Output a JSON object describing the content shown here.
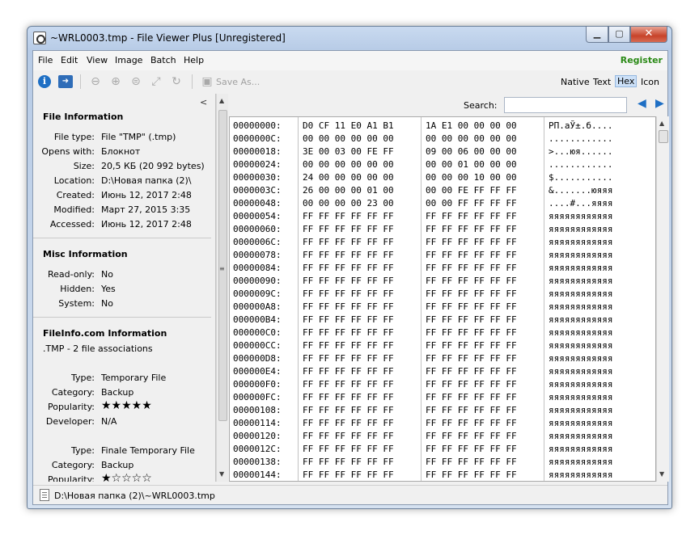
{
  "window": {
    "title": "~WRL0003.tmp - File Viewer Plus [Unregistered]",
    "min": "▁",
    "max": "▢",
    "close": "✕"
  },
  "menu": {
    "items": [
      "File",
      "Edit",
      "View",
      "Image",
      "Batch",
      "Help"
    ],
    "register": "Register"
  },
  "toolbar": {
    "save_label": "Save As...",
    "view_modes": [
      "Native",
      "Text",
      "Hex",
      "Icon"
    ],
    "active_view": "Hex"
  },
  "left_pane": {
    "collapse_glyph": "<",
    "file_info": {
      "heading": "File Information",
      "rows": [
        {
          "label": "File type:",
          "value": "File \"TMP\" (.tmp)"
        },
        {
          "label": "Opens with:",
          "value": "Блокнот"
        },
        {
          "label": "Size:",
          "value": "20,5 КБ (20 992 bytes)"
        },
        {
          "label": "Location:",
          "value": "D:\\Новая папка (2)\\"
        },
        {
          "label": "Created:",
          "value": "Июнь 12, 2017 2:48"
        },
        {
          "label": "Modified:",
          "value": "Март 27, 2015 3:35"
        },
        {
          "label": "Accessed:",
          "value": "Июнь 12, 2017 2:48"
        }
      ]
    },
    "misc_info": {
      "heading": "Misc Information",
      "rows": [
        {
          "label": "Read-only:",
          "value": "No"
        },
        {
          "label": "Hidden:",
          "value": "Yes"
        },
        {
          "label": "System:",
          "value": "No"
        }
      ]
    },
    "fileinfo_com": {
      "heading": "FileInfo.com Information",
      "associations": ".TMP - 2 file associations",
      "entries": [
        {
          "type_label": "Type:",
          "type": "Temporary File",
          "category_label": "Category:",
          "category": "Backup",
          "popularity_label": "Popularity:",
          "popularity_stars": "★★★★★",
          "developer_label": "Developer:",
          "developer": "N/A"
        },
        {
          "type_label": "Type:",
          "type": "Finale Temporary File",
          "category_label": "Category:",
          "category": "Backup",
          "popularity_label": "Popularity:",
          "popularity_stars": "★☆☆☆☆"
        }
      ]
    }
  },
  "search": {
    "label": "Search:",
    "value": "",
    "prev": "◀",
    "next": "▶"
  },
  "hex_rows": [
    {
      "offset": "00000000:",
      "h1": "D0 CF 11 E0 A1 B1",
      "h2": "1A E1 00 00 00 00",
      "ascii": "РП.аЎ±.б...."
    },
    {
      "offset": "0000000C:",
      "h1": "00 00 00 00 00 00",
      "h2": "00 00 00 00 00 00",
      "ascii": "............"
    },
    {
      "offset": "00000018:",
      "h1": "3E 00 03 00 FE FF",
      "h2": "09 00 06 00 00 00",
      "ascii": ">...юя......"
    },
    {
      "offset": "00000024:",
      "h1": "00 00 00 00 00 00",
      "h2": "00 00 01 00 00 00",
      "ascii": "............"
    },
    {
      "offset": "00000030:",
      "h1": "24 00 00 00 00 00",
      "h2": "00 00 00 10 00 00",
      "ascii": "$..........."
    },
    {
      "offset": "0000003C:",
      "h1": "26 00 00 00 01 00",
      "h2": "00 00 FE FF FF FF",
      "ascii": "&.......юяяя"
    },
    {
      "offset": "00000048:",
      "h1": "00 00 00 00 23 00",
      "h2": "00 00 FF FF FF FF",
      "ascii": "....#...яяяя"
    },
    {
      "offset": "00000054:",
      "h1": "FF FF FF FF FF FF",
      "h2": "FF FF FF FF FF FF",
      "ascii": "яяяяяяяяяяяя"
    },
    {
      "offset": "00000060:",
      "h1": "FF FF FF FF FF FF",
      "h2": "FF FF FF FF FF FF",
      "ascii": "яяяяяяяяяяяя"
    },
    {
      "offset": "0000006C:",
      "h1": "FF FF FF FF FF FF",
      "h2": "FF FF FF FF FF FF",
      "ascii": "яяяяяяяяяяяя"
    },
    {
      "offset": "00000078:",
      "h1": "FF FF FF FF FF FF",
      "h2": "FF FF FF FF FF FF",
      "ascii": "яяяяяяяяяяяя"
    },
    {
      "offset": "00000084:",
      "h1": "FF FF FF FF FF FF",
      "h2": "FF FF FF FF FF FF",
      "ascii": "яяяяяяяяяяяя"
    },
    {
      "offset": "00000090:",
      "h1": "FF FF FF FF FF FF",
      "h2": "FF FF FF FF FF FF",
      "ascii": "яяяяяяяяяяяя"
    },
    {
      "offset": "0000009C:",
      "h1": "FF FF FF FF FF FF",
      "h2": "FF FF FF FF FF FF",
      "ascii": "яяяяяяяяяяяя"
    },
    {
      "offset": "000000A8:",
      "h1": "FF FF FF FF FF FF",
      "h2": "FF FF FF FF FF FF",
      "ascii": "яяяяяяяяяяяя"
    },
    {
      "offset": "000000B4:",
      "h1": "FF FF FF FF FF FF",
      "h2": "FF FF FF FF FF FF",
      "ascii": "яяяяяяяяяяяя"
    },
    {
      "offset": "000000C0:",
      "h1": "FF FF FF FF FF FF",
      "h2": "FF FF FF FF FF FF",
      "ascii": "яяяяяяяяяяяя"
    },
    {
      "offset": "000000CC:",
      "h1": "FF FF FF FF FF FF",
      "h2": "FF FF FF FF FF FF",
      "ascii": "яяяяяяяяяяяя"
    },
    {
      "offset": "000000D8:",
      "h1": "FF FF FF FF FF FF",
      "h2": "FF FF FF FF FF FF",
      "ascii": "яяяяяяяяяяяя"
    },
    {
      "offset": "000000E4:",
      "h1": "FF FF FF FF FF FF",
      "h2": "FF FF FF FF FF FF",
      "ascii": "яяяяяяяяяяяя"
    },
    {
      "offset": "000000F0:",
      "h1": "FF FF FF FF FF FF",
      "h2": "FF FF FF FF FF FF",
      "ascii": "яяяяяяяяяяяя"
    },
    {
      "offset": "000000FC:",
      "h1": "FF FF FF FF FF FF",
      "h2": "FF FF FF FF FF FF",
      "ascii": "яяяяяяяяяяяя"
    },
    {
      "offset": "00000108:",
      "h1": "FF FF FF FF FF FF",
      "h2": "FF FF FF FF FF FF",
      "ascii": "яяяяяяяяяяяя"
    },
    {
      "offset": "00000114:",
      "h1": "FF FF FF FF FF FF",
      "h2": "FF FF FF FF FF FF",
      "ascii": "яяяяяяяяяяяя"
    },
    {
      "offset": "00000120:",
      "h1": "FF FF FF FF FF FF",
      "h2": "FF FF FF FF FF FF",
      "ascii": "яяяяяяяяяяяя"
    },
    {
      "offset": "0000012C:",
      "h1": "FF FF FF FF FF FF",
      "h2": "FF FF FF FF FF FF",
      "ascii": "яяяяяяяяяяяя"
    },
    {
      "offset": "00000138:",
      "h1": "FF FF FF FF FF FF",
      "h2": "FF FF FF FF FF FF",
      "ascii": "яяяяяяяяяяяя"
    },
    {
      "offset": "00000144:",
      "h1": "FF FF FF FF FF FF",
      "h2": "FF FF FF FF FF FF",
      "ascii": "яяяяяяяяяяяя"
    }
  ],
  "status": {
    "path": "D:\\Новая папка (2)\\~WRL0003.tmp"
  },
  "colors": {
    "register": "#2b8a17",
    "accent": "#1e6fc4"
  }
}
